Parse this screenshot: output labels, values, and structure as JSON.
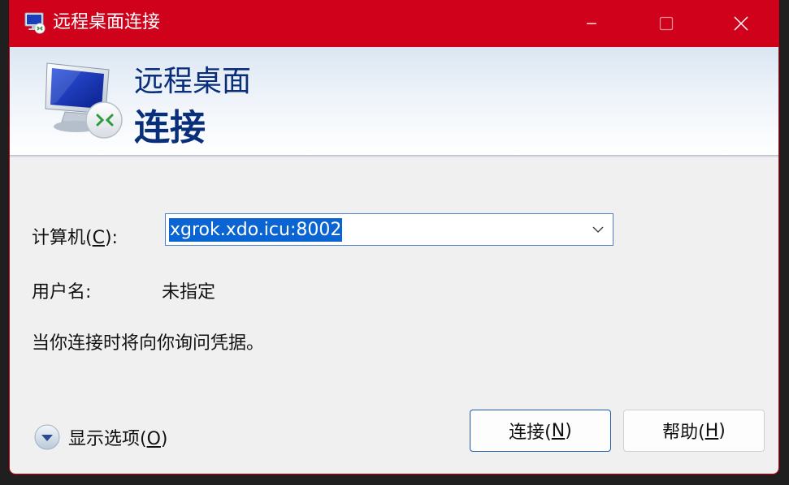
{
  "window": {
    "title": "远程桌面连接",
    "accent_color": "#d0021b",
    "controls": {
      "minimize": "minimize-icon",
      "maximize": "maximize-icon",
      "close": "close-icon"
    }
  },
  "banner": {
    "line1": "远程桌面",
    "line2": "连接",
    "icon": "remote-desktop-monitor-icon"
  },
  "form": {
    "computer_label_prefix": "计算机(",
    "computer_label_key": "C",
    "computer_label_suffix": "):",
    "computer_value": "xgrok.xdo.icu:8002",
    "user_label": "用户名:",
    "user_value": "未指定",
    "info": "当你连接时将向你询问凭据。"
  },
  "options_toggle": {
    "label_prefix": "显示选项(",
    "label_key": "O",
    "label_suffix": ")",
    "icon": "chevron-down-circle-icon"
  },
  "buttons": {
    "connect_prefix": "连接(",
    "connect_key": "N",
    "connect_suffix": ")",
    "help_prefix": "帮助(",
    "help_key": "H",
    "help_suffix": ")"
  }
}
